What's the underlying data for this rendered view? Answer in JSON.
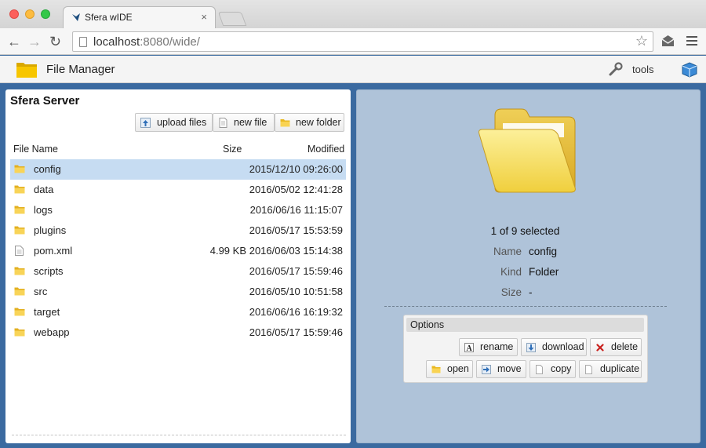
{
  "browser": {
    "tab_title": "Sfera wIDE",
    "tab_close": "×",
    "url_host": "localhost",
    "url_rest": ":8080/wide/"
  },
  "app": {
    "title": "File Manager",
    "tools_label": "tools"
  },
  "left_panel": {
    "server_title": "Sfera Server",
    "buttons": {
      "upload": "upload files",
      "new_file": "new file",
      "new_folder": "new folder"
    },
    "columns": {
      "name": "File Name",
      "size": "Size",
      "modified": "Modified"
    },
    "files": [
      {
        "name": "config",
        "size": "",
        "modified": "2015/12/10 09:26:00",
        "type": "folder",
        "selected": true
      },
      {
        "name": "data",
        "size": "",
        "modified": "2016/05/02 12:41:28",
        "type": "folder"
      },
      {
        "name": "logs",
        "size": "",
        "modified": "2016/06/16 11:15:07",
        "type": "folder"
      },
      {
        "name": "plugins",
        "size": "",
        "modified": "2016/05/17 15:53:59",
        "type": "folder"
      },
      {
        "name": "pom.xml",
        "size": "4.99 KB",
        "modified": "2016/06/03 15:14:38",
        "type": "file"
      },
      {
        "name": "scripts",
        "size": "",
        "modified": "2016/05/17 15:59:46",
        "type": "folder"
      },
      {
        "name": "src",
        "size": "",
        "modified": "2016/05/10 10:51:58",
        "type": "folder"
      },
      {
        "name": "target",
        "size": "",
        "modified": "2016/06/16 16:19:32",
        "type": "folder"
      },
      {
        "name": "webapp",
        "size": "",
        "modified": "2016/05/17 15:59:46",
        "type": "folder"
      }
    ]
  },
  "right_panel": {
    "selection_count": "1 of 9 selected",
    "props": {
      "name_label": "Name",
      "name_value": "config",
      "kind_label": "Kind",
      "kind_value": "Folder",
      "size_label": "Size",
      "size_value": "-"
    },
    "options": {
      "title": "Options",
      "rename": "rename",
      "download": "download",
      "delete": "delete",
      "open": "open",
      "move": "move",
      "copy": "copy",
      "duplicate": "duplicate"
    }
  },
  "colors": {
    "accent_blue": "#3b6aa0",
    "selection": "#c6dcf2",
    "detail_bg": "#afc3d9",
    "folder_yellow": "#f2c94c"
  }
}
